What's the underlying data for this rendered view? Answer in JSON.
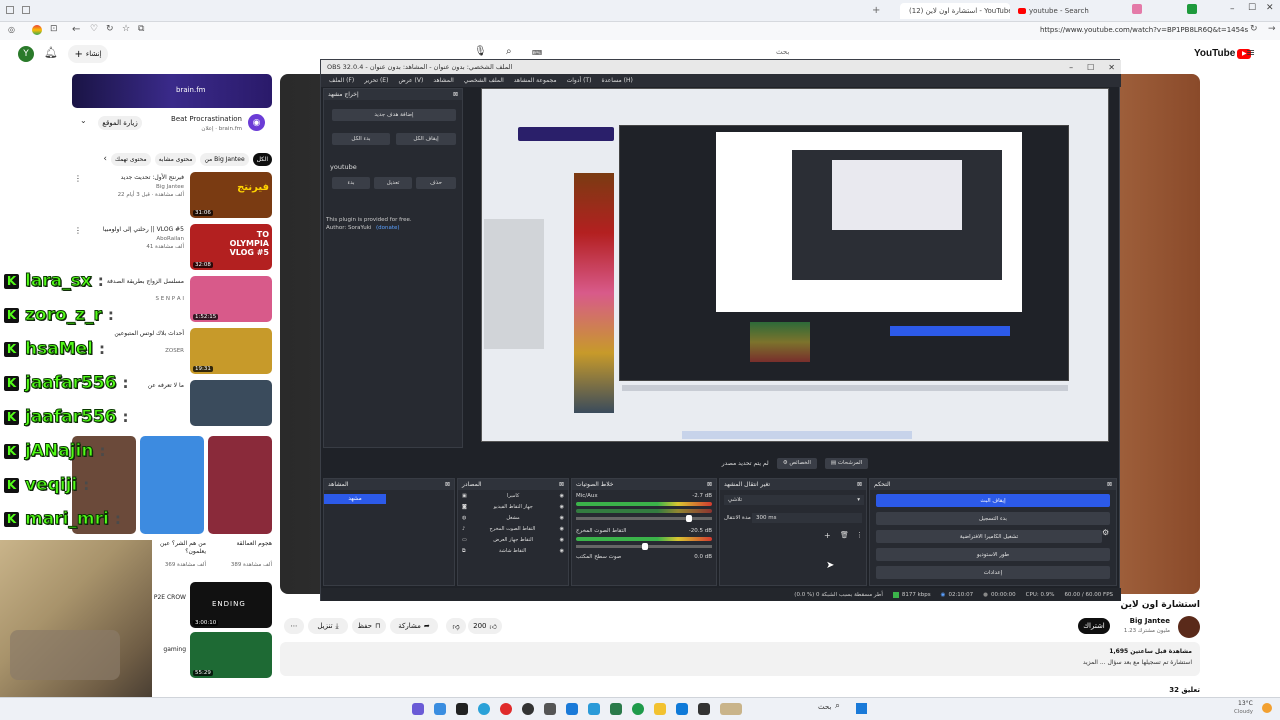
{
  "browser": {
    "tabs": [
      {
        "label": "استشارة اون لاين (12) - YouTube"
      },
      {
        "label": "youtube - Search"
      }
    ],
    "url": "https://www.youtube.com/watch?v=BP1PB8LR6Q&t=1454s",
    "address_search_placeholder": "بحث"
  },
  "youtube": {
    "logo_text": "YouTube",
    "create_label": "إنشاء",
    "filter_chips": [
      "الكل",
      "من Big Jantee",
      "محتوى مشابه",
      "محتوى تهمك"
    ],
    "ad": {
      "brand": "brain.fm",
      "title": "Beat Procrastination",
      "subtitle": "إعلان · brain.fm",
      "visit_button": "زيارة الموقع"
    },
    "suggested": [
      {
        "title": "فيرنتج الأول: تحديث جديد",
        "channel": "Big Jantee",
        "meta": "22 ألف مشاهدة · قبل 3 أيام",
        "duration": "31:06",
        "thumb_color": "#7a3b12",
        "thumb_text": "فيرنتج"
      },
      {
        "title": "رحلتي إلى اولومبيا || VLOG #5",
        "channel": "AboRailan",
        "meta": "41 ألف مشاهدة",
        "duration": "32:08",
        "thumb_color": "#b32020",
        "thumb_text": "TO OLYMPIA VLOG #5"
      },
      {
        "title": "مسلسل الزواج بطريقة الصدفة",
        "channel": "S E N P A I",
        "meta": "",
        "duration": "1:52:15",
        "thumb_color": "#d85a8a",
        "thumb_text": ""
      },
      {
        "title": "أحداث بلاك لوتس المتبوعين",
        "channel": "ZOSER",
        "meta": "",
        "duration": "19:31",
        "thumb_color": "#c79a2a",
        "thumb_text": ""
      },
      {
        "title": "ما لا تعرفه عن",
        "channel": "",
        "meta": "",
        "duration": "",
        "thumb_color": "#3a4b5c",
        "thumb_text": ""
      }
    ],
    "shorts": [
      {
        "title": "من هم الشر؟ عين يعلمون؟",
        "meta": "",
        "color": "#6b4a3a"
      },
      {
        "title": "نكتشف الكثير في",
        "meta": "369 ألف مشاهدة",
        "color": "#3d8be0"
      },
      {
        "title": "هجوم العمالقة",
        "meta": "389 ألف مشاهدة",
        "color": "#8a2a3a"
      }
    ],
    "more_videos": [
      {
        "title": "P2E CROW",
        "meta": "",
        "duration": "3:00:10",
        "thumb_color": "#111111",
        "thumb_text": "ENDING"
      },
      {
        "title": "gaming",
        "meta": "",
        "duration": "55:29",
        "thumb_color": "#1e6a34",
        "thumb_text": ""
      }
    ],
    "video": {
      "title": "استشارة اون لاين",
      "channel": "Big Jantee",
      "subscribers": "1.23 مليون مشترك",
      "subscribe_label": "اشتراك",
      "like_count": "200",
      "share_label": "مشاركة",
      "save_label": "حفظ",
      "download_label": "تنزيل",
      "views_line": "1,695 مشاهدة قبل ساعتين",
      "description": "استشارة تم تسجيلها مع بعد سؤال ... المزيد",
      "comments_line": "32 تعليق"
    }
  },
  "kick_chat": [
    {
      "name": "lara_sx",
      "color": "#53fc18"
    },
    {
      "name": "zoro_z_r",
      "color": "#53fc18"
    },
    {
      "name": "hsaMel",
      "color": "#53fc18"
    },
    {
      "name": "jaafar556",
      "color": "#53fc18"
    },
    {
      "name": "jaafar556",
      "color": "#53fc18"
    },
    {
      "name": "jANajin",
      "color": "#53fc18"
    },
    {
      "name": "veqiji",
      "color": "#53fc18"
    },
    {
      "name": "mari_mri",
      "color": "#53fc18"
    }
  ],
  "obs": {
    "title": "OBS 32.0.4 - الملف الشخصي: بدون عنوان - المشاهد: بدون عنوان",
    "menu": [
      "الملف (F)",
      "تحرير (E)",
      "عرض (V)",
      "المشاهد",
      "الملف الشخصي",
      "مجموعة المشاهد",
      "أدوات (T)",
      "مساعدة (H)"
    ],
    "plugin_dock": {
      "title": "إخراج مشهد",
      "add_button": "إضافة هدف جديد",
      "start_all": "بدء الكل",
      "stop_all": "إيقاف الكل",
      "target_name": "youtube",
      "start": "بدء",
      "edit": "تعديل",
      "delete": "حذف",
      "info_line1": "This plugin is provided for free.",
      "info_line2": "Author: SoraYuki",
      "donate": "(donate)"
    },
    "preview_mode_labels": [
      "لم يتم تحديد مصدر",
      "الخصائص",
      "المرشحات"
    ],
    "docks": {
      "scenes": {
        "title": "المشاهد",
        "items": [
          "مشهد"
        ]
      },
      "sources": {
        "title": "المصادر",
        "items": [
          "كاميرا",
          "جهاز التقاط الفيديو",
          "مشغل",
          "التقاط الصوت المخرج",
          "التقاط جهاز العرض",
          "التقاط شاشة"
        ]
      },
      "mixer": {
        "title": "خلاط الصوتيات",
        "channels": [
          {
            "name": "Mic/Aux",
            "db": "-2.7 dB"
          },
          {
            "name": "التقاط الصوت المخرج",
            "db": "-20.5 dB"
          },
          {
            "name": "صوت سطح المكتب",
            "db": "0.0 dB"
          }
        ]
      },
      "transitions": {
        "title": "تغير انتقال المشهد",
        "type": "تلاشي",
        "duration_label": "مدة الانتقال",
        "duration_value": "300 ms"
      },
      "controls": {
        "title": "التحكم",
        "buttons": [
          "إيقاف البث",
          "بدء التسجيل",
          "تشغيل الكاميرا الافتراضية",
          "طور الاستوديو",
          "إعدادات",
          "خروج"
        ]
      }
    },
    "status": {
      "dropped": "(0.0 %) 0 أطر مسقطة بسبب الشبكة",
      "bitrate": "8177 kbps",
      "stream_time": "02:10:07",
      "rec_time": "00:00:00",
      "cpu": "CPU: 0.9%",
      "fps": "60.00 / 60.00 FPS"
    }
  },
  "taskbar": {
    "search_placeholder": "بحث",
    "temperature": "13°C",
    "weather": "Cloudy"
  },
  "colors": {
    "obs_bg": "#1f2228",
    "obs_accent": "#2c5ae9",
    "kick_green": "#53fc18",
    "yt_red": "#ff0000"
  }
}
